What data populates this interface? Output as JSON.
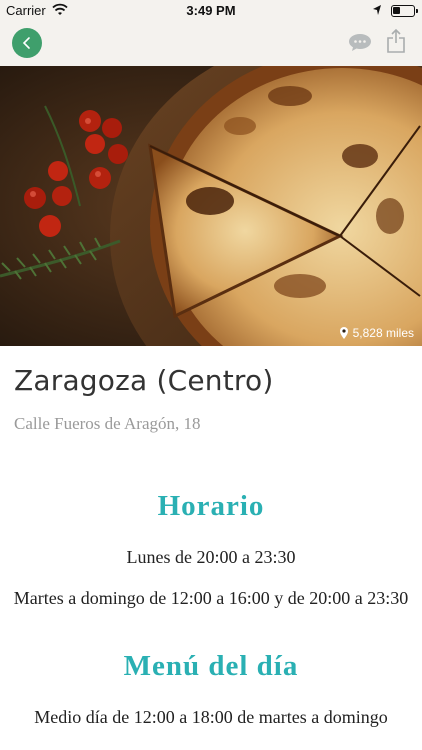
{
  "status_bar": {
    "carrier": "Carrier",
    "time": "3:49 PM"
  },
  "nav": {
    "back_icon": "chevron-left-icon",
    "comment_icon": "comment-icon",
    "share_icon": "share-icon",
    "accent_color": "#3f9f6c"
  },
  "hero": {
    "distance": "5,828 miles",
    "distance_icon": "location-pin-icon"
  },
  "restaurant": {
    "name": "Zaragoza (Centro)",
    "address": "Calle Fueros de Aragón, 18"
  },
  "schedule": {
    "title": "Horario",
    "line1": "Lunes de 20:00 a 23:30",
    "line2": "Martes a domingo de 12:00 a 16:00 y de 20:00 a 23:30"
  },
  "menu": {
    "title": "Menú del día",
    "line1": "Medio día de 12:00 a 18:00 de martes a domingo"
  },
  "colors": {
    "section_title": "#2ab0b3",
    "bar_background": "#f4f2ee"
  }
}
